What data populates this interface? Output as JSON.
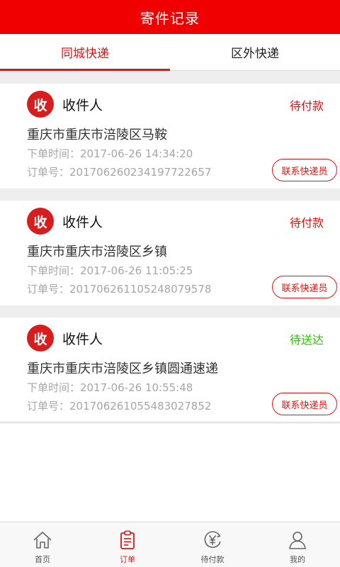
{
  "header": {
    "title": "寄件记录"
  },
  "tabs": [
    {
      "label": "同城快递",
      "active": true
    },
    {
      "label": "区外快递",
      "active": false
    }
  ],
  "badge_text": "收",
  "contact_label": "联系快递员",
  "colors": {
    "brand_red": "#f10000",
    "accent_red": "#e8110c",
    "status_green": "#2ec600",
    "muted": "#a6a6a6"
  },
  "orders": [
    {
      "recipient": "收件人",
      "status": "待付款",
      "address": "重庆市重庆市涪陵区马鞍",
      "time": "下单时间：2017-06-26 14:34:20",
      "order_no": "订单号：20170626023419772​2657"
    },
    {
      "recipient": "收件人",
      "status": "待付款",
      "address": "重庆市重庆市涪陵区乡镇",
      "time": "下单时间：2017-06-26 11:05:25",
      "order_no": "订单号：20170626110524807957​8"
    },
    {
      "recipient": "收件人",
      "status": "待送达",
      "address": "重庆市重庆市涪陵区乡镇圆通速递",
      "time": "下单时间：2017-06-26 10:55:48",
      "order_no": "订单号：20170626105548302785​2"
    }
  ],
  "bottom_nav": [
    {
      "label": "首页",
      "icon": "home-icon"
    },
    {
      "label": "订单",
      "icon": "clipboard-icon",
      "active": true
    },
    {
      "label": "待付款",
      "icon": "yen-icon"
    },
    {
      "label": "我的",
      "icon": "user-icon"
    }
  ]
}
